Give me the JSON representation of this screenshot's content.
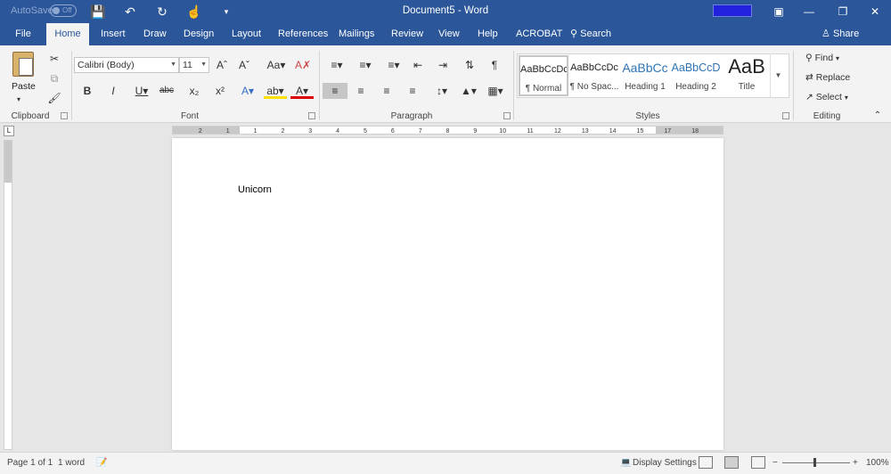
{
  "titlebar": {
    "autosave_label": "AutoSave",
    "toggle_state": "Off",
    "document_title": "Document5 - Word"
  },
  "tabs": [
    "File",
    "Home",
    "Insert",
    "Draw",
    "Design",
    "Layout",
    "References",
    "Mailings",
    "Review",
    "View",
    "Help",
    "ACROBAT"
  ],
  "active_tab": "Home",
  "search_label": "Search",
  "share_label": "Share",
  "ribbon": {
    "clipboard": {
      "paste_label": "Paste",
      "group_label": "Clipboard"
    },
    "font": {
      "font_name": "Calibri (Body)",
      "font_size": "11",
      "group_label": "Font"
    },
    "paragraph": {
      "group_label": "Paragraph"
    },
    "styles": {
      "items": [
        {
          "sample": "AaBbCcDc",
          "name": "¶ Normal"
        },
        {
          "sample": "AaBbCcDc",
          "name": "¶ No Spac..."
        },
        {
          "sample": "AaBbCc",
          "name": "Heading 1"
        },
        {
          "sample": "AaBbCcD",
          "name": "Heading 2"
        },
        {
          "sample": "AaB",
          "name": "Title"
        }
      ],
      "group_label": "Styles"
    },
    "editing": {
      "find": "Find",
      "replace": "Replace",
      "select": "Select",
      "group_label": "Editing"
    }
  },
  "ruler": {
    "ticks": [
      "2",
      "1",
      "1",
      "2",
      "3",
      "4",
      "5",
      "6",
      "7",
      "8",
      "9",
      "10",
      "11",
      "12",
      "13",
      "14",
      "15",
      "17",
      "18"
    ]
  },
  "document": {
    "text": "Unicorn"
  },
  "statusbar": {
    "page": "Page 1 of 1",
    "words": "1 word",
    "display_settings": "Display Settings",
    "zoom": "100%"
  }
}
